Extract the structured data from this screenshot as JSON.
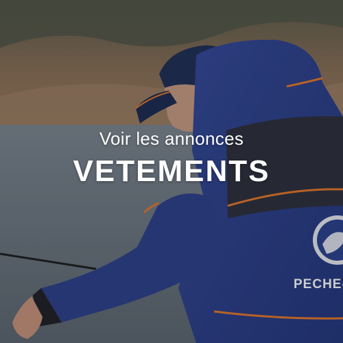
{
  "tile": {
    "subtitle": "Voir les annonces",
    "title": "VETEMENTS",
    "jacket_brand_text": "PECHE-FI"
  },
  "colors": {
    "jacket_blue": "#2b3f8f",
    "trim_orange": "#e8782a",
    "water": "#6b7580",
    "text": "#ffffff"
  }
}
